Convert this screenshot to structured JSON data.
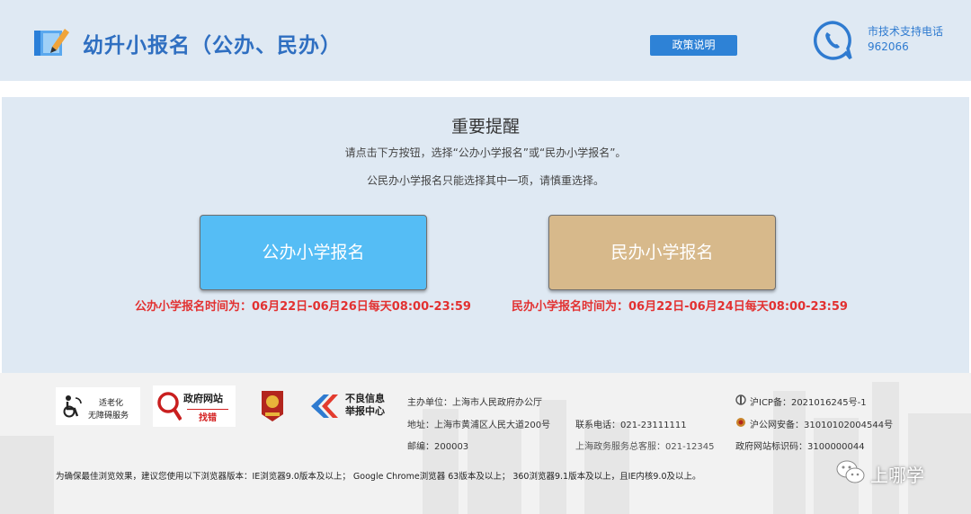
{
  "header": {
    "title": "幼升小报名（公办、民办）",
    "policy_button": "政策说明",
    "support_label": "市技术支持电话",
    "support_number": "962066"
  },
  "notice": {
    "title": "重要提醒",
    "line1": "请点击下方按钮，选择“公办小学报名”或“民办小学报名”。",
    "line2": "公民办小学报名只能选择其中一项，请慎重选择。"
  },
  "options": {
    "public_label": "公办小学报名",
    "public_time": "公办小学报名时间为：06月22日-06月26日每天08:00-23:59",
    "private_label": "民办小学报名",
    "private_time": "民办小学报名时间为：06月22日-06月24日每天08:00-23:59"
  },
  "footer": {
    "badges": {
      "access_line1": "适老化",
      "access_line2": "无障碍服务",
      "gov_title": "政府网站",
      "gov_sub": "找错",
      "report_line1": "不良信息",
      "report_line2": "举报中心"
    },
    "host": "主办单位：上海市人民政府办公厅",
    "address": "地址：上海市黄浦区人民大道200号",
    "postcode": "邮编：200003",
    "phone": "联系电话：021-23111111",
    "service_phone": "上海政务服务总客服：021-12345",
    "icp": "沪ICP备：2021016245号-1",
    "police": "沪公网安备：31010102004544号",
    "site_code": "政府网站标识码：3100000044",
    "browser_note": "为确保最佳浏览效果，建议您使用以下浏览器版本：IE浏览器9.0版本及以上； Google Chrome浏览器 63版本及以上； 360浏览器9.1版本及以上，且IE内核9.0及以上。"
  },
  "watermark": "上哪学",
  "colors": {
    "header_bg": "#dfe9f3",
    "title_blue": "#2f6fc1",
    "public_button": "#55bdf5",
    "private_button": "#d7b98b",
    "time_red": "#e23131"
  }
}
